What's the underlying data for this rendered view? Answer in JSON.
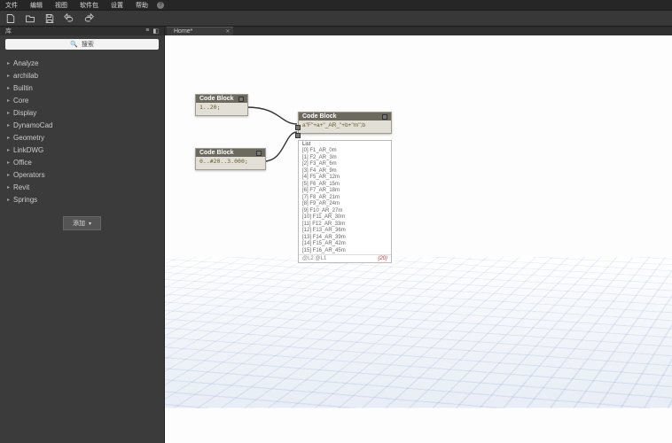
{
  "menu": {
    "items": [
      "文件",
      "编辑",
      "视图",
      "软件包",
      "设置",
      "帮助"
    ]
  },
  "sidebar": {
    "title": "库",
    "search_placeholder": "搜索",
    "categories": [
      "Analyze",
      "archilab",
      "Builtin",
      "Core",
      "Display",
      "DynamoCad",
      "Geometry",
      "LinkDWG",
      "Office",
      "Operators",
      "Revit",
      "Springs"
    ],
    "add_label": "添加"
  },
  "tab": {
    "title": "Home*"
  },
  "nodes": {
    "block1": {
      "title": "Code Block",
      "code": "1..20;"
    },
    "block2": {
      "title": "Code Block",
      "code": "0..#20..3.000;"
    },
    "block3": {
      "title": "Code Block",
      "inputs": [
        "a",
        "b"
      ],
      "code": "\"F\"+a+\"_AR_\"+b+\"m\";"
    }
  },
  "output": {
    "header": "List",
    "rows": [
      "[0] F1_AR_0m",
      "[1] F2_AR_3m",
      "[2] F3_AR_6m",
      "[3] F4_AR_9m",
      "[4] F5_AR_12m",
      "[5] F6_AR_15m",
      "[6] F7_AR_18m",
      "[7] F8_AR_21m",
      "[8] F9_AR_24m",
      "[9] F10_AR_27m",
      "[10] F11_AR_30m",
      "[11] F12_AR_33m",
      "[12] F13_AR_36m",
      "[13] F14_AR_39m",
      "[14] F15_AR_42m",
      "[15] F16_AR_45m"
    ],
    "level_label": "@L2 @L1",
    "count": "{20}"
  }
}
